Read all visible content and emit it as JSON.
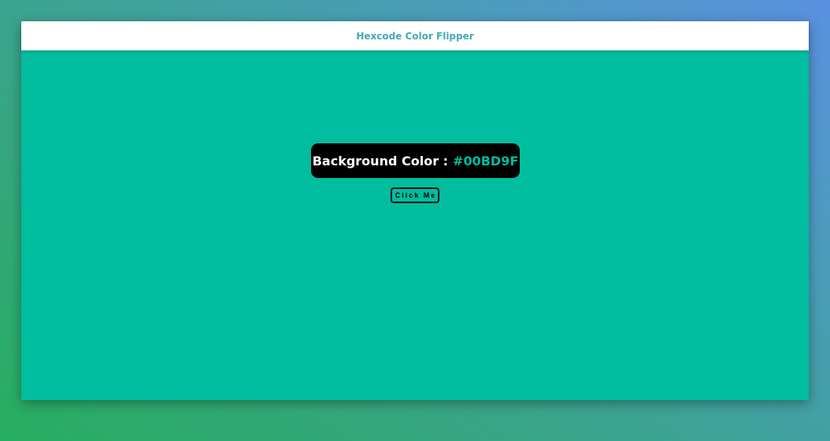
{
  "navbar": {
    "title": "Hexcode Color Flipper"
  },
  "main": {
    "background_color": "#00BD9F",
    "color_label": "Background Color :",
    "color_value": "#00BD9F",
    "button_label": "Click Me"
  },
  "colors": {
    "navbar_title": "#47a9b3",
    "display_box": "#000000",
    "label_text": "#ffffff"
  }
}
